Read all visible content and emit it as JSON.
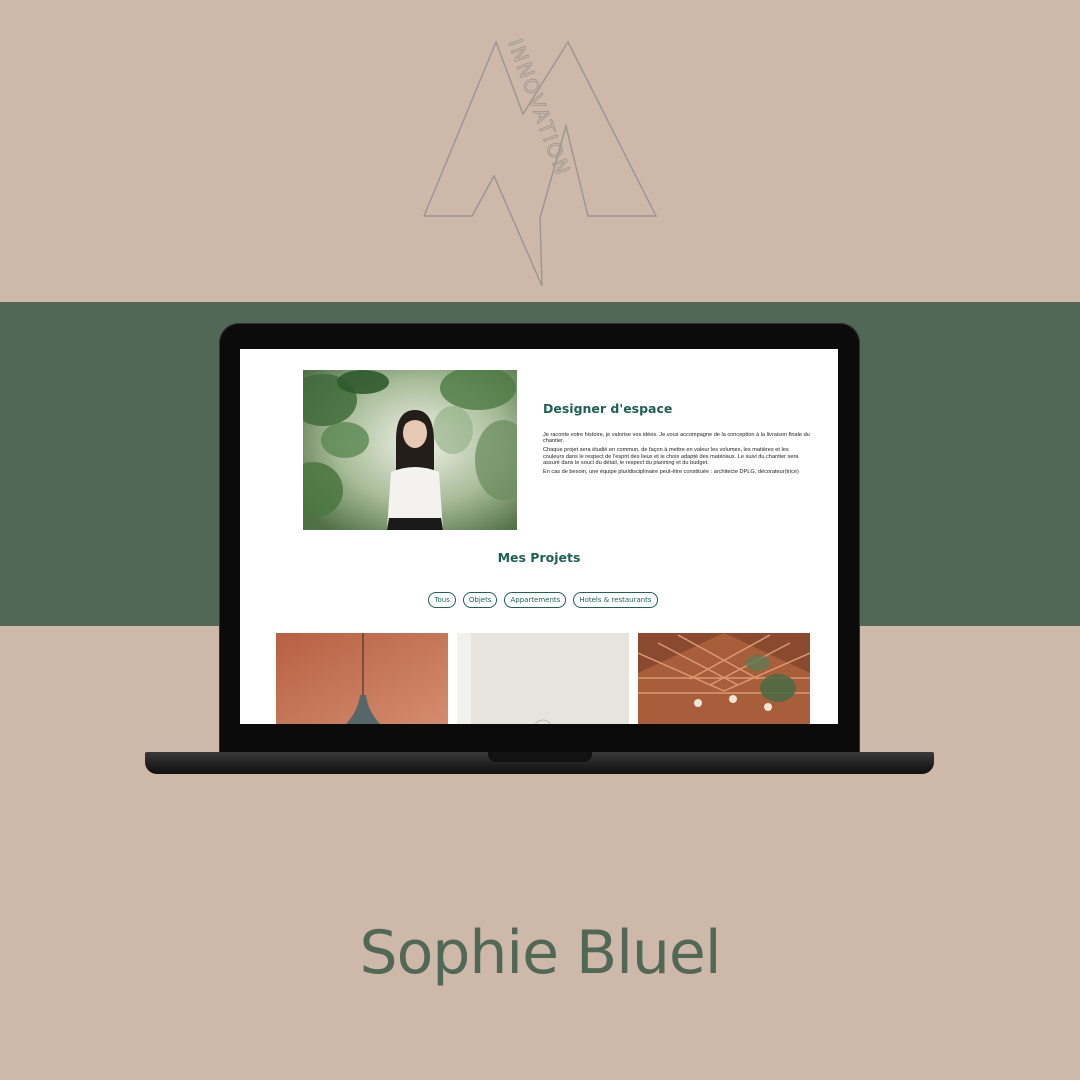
{
  "logo": {
    "text": "INNOVATION",
    "initials": "M"
  },
  "site": {
    "about": {
      "title": "Designer d'espace",
      "paragraphs": [
        "Je raconte votre histoire, je valorise vos idées. Je vous accompagne de la conception à la livraison finale du chantier.",
        "Chaque projet sera étudié en commun, de façon à mettre en valeur les volumes, les matières et les couleurs dans le respect de l'esprit des lieux et le choix adapté des matériaux. Le suivi du chantier sera assuré dans le souci du détail, le respect du planning et du budget.",
        "En cas de besoin, une équipe pluridisciplinaire peut-être constituée : architecte DPLG, décorateur(trice)"
      ]
    },
    "projects": {
      "title": "Mes Projets",
      "filters": [
        "Tous",
        "Objets",
        "Appartements",
        "Hotels & restaurants"
      ]
    }
  },
  "footer": {
    "name": "Sophie Bluel"
  },
  "colors": {
    "background": "#cdb8a9",
    "band": "#516856",
    "accent": "#1d6154"
  }
}
